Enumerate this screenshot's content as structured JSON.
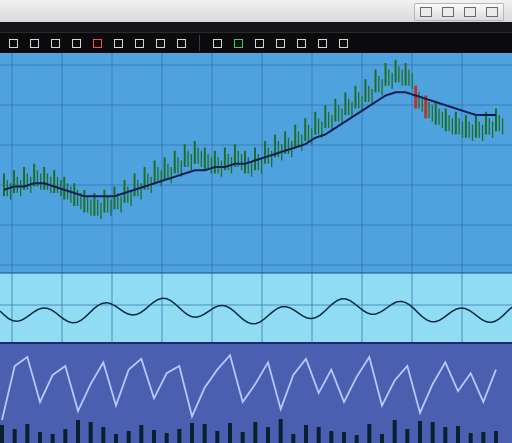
{
  "window": {
    "controls": [
      "minimize",
      "settings",
      "maximize",
      "close"
    ]
  },
  "toolbar": {
    "left_icons": [
      "lock-icon",
      "cross-icon",
      "wave-icon",
      "grid-icon",
      "chart-icon",
      "pin-icon",
      "up-arrow-icon",
      "down-arrow-icon",
      "drag-icon"
    ],
    "right_icons": [
      "folder-icon",
      "chart-up-icon",
      "chart-down-icon",
      "zoom-icon",
      "settings-icon",
      "grid-icon",
      "window-icon"
    ]
  },
  "colors": {
    "price_panel_bg": "#4ea3df",
    "grid": "#2f6fa8",
    "candles": "#1f6e24",
    "candles_down": "#c0322b",
    "moving_average": "#0f1f55",
    "lower_band": "#8fdcf3",
    "oscillator_bg": "#4a5fb0",
    "oscillator_line": "#b9c6ff",
    "volume": "#0a2030"
  },
  "chart_data": {
    "type": "line",
    "series": [
      {
        "values": [
          23,
          24,
          25,
          26,
          25,
          24,
          22,
          20,
          18,
          17,
          18,
          19,
          21,
          23,
          25,
          27,
          28,
          30,
          32,
          33,
          31,
          30,
          31,
          32,
          30,
          31,
          33,
          35,
          36,
          38,
          40,
          42,
          44,
          46,
          48,
          50,
          52,
          55,
          57,
          58,
          57,
          50,
          47,
          45,
          43,
          42,
          41,
          41,
          42,
          43
        ]
      },
      {
        "values": [
          21,
          22,
          22,
          23,
          23,
          22,
          21,
          20,
          19,
          19,
          19,
          19,
          20,
          21,
          22,
          23,
          24,
          25,
          26,
          27,
          27,
          28,
          28,
          29,
          29,
          30,
          31,
          32,
          33,
          34,
          35,
          37,
          38,
          40,
          42,
          44,
          46,
          48,
          50,
          51,
          51,
          50,
          49,
          48,
          47,
          46,
          45,
          44,
          44,
          44
        ]
      }
    ],
    "lower_panel": {
      "values": [
        10,
        40,
        45,
        20,
        35,
        40,
        15,
        30,
        42,
        18,
        38,
        44,
        22,
        36,
        40,
        12,
        28,
        38,
        46,
        20,
        30,
        42,
        16,
        35,
        44,
        25,
        38,
        20,
        34,
        45,
        18,
        32,
        40,
        14,
        30,
        42,
        26,
        36,
        20,
        38
      ]
    }
  }
}
